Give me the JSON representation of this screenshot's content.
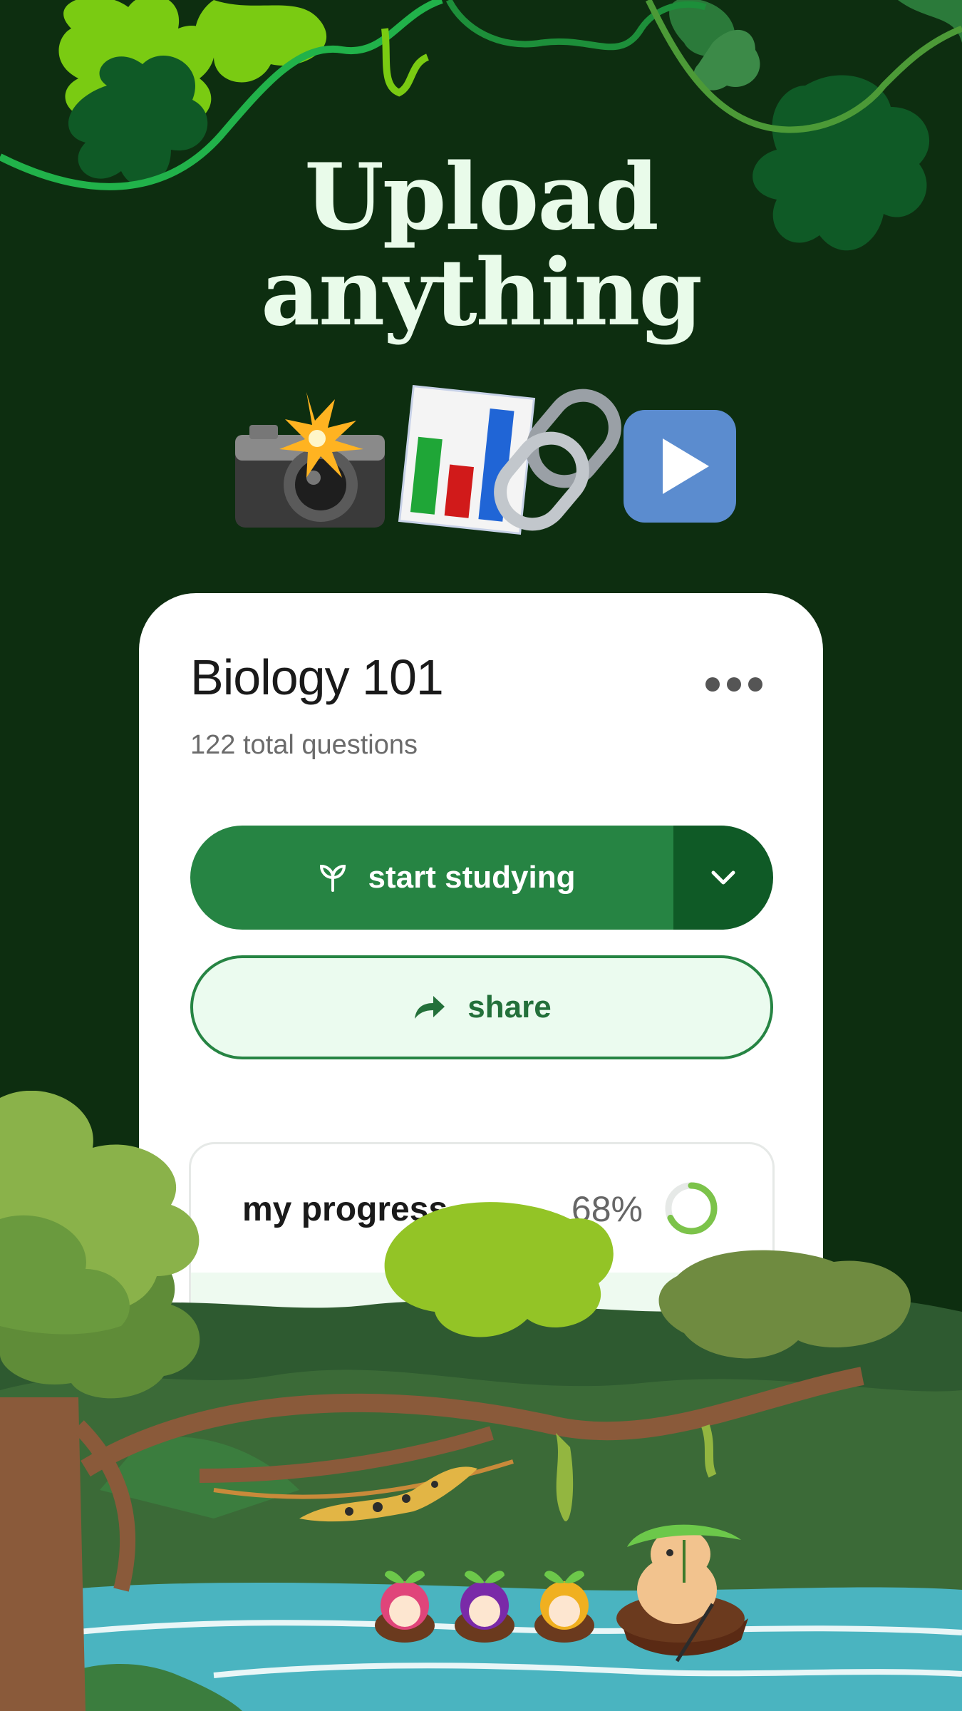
{
  "hero": {
    "line1": "Upload",
    "line2": "anything",
    "icons": [
      "camera-flash-icon",
      "bar-chart-icon",
      "link-icon",
      "play-button-icon"
    ]
  },
  "card": {
    "title": "Biology 101",
    "subtitle": "122 total questions",
    "more_icon": "ellipsis-icon",
    "start_label": "start studying",
    "start_icon": "sprout-icon",
    "dropdown_icon": "chevron-down-icon",
    "share_label": "share",
    "share_icon": "share-arrow-icon",
    "progress": {
      "label": "my progress",
      "percent_text": "68%",
      "value": 0.68
    }
  },
  "colors": {
    "background": "#0d2e10",
    "primary": "#268443",
    "primary_dark": "#0f5a26",
    "share_bg": "#ebfbef",
    "ring": "#7cc34a"
  }
}
